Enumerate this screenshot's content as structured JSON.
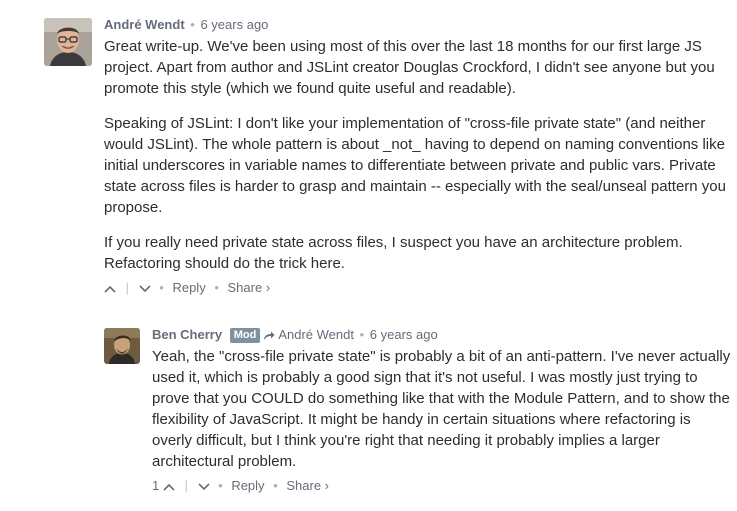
{
  "comments": [
    {
      "author": "André Wendt",
      "time": "6 years ago",
      "paragraphs": [
        "Great write-up. We've been using most of this over the last 18 months for our first large JS project. Apart from author and JSLint creator Douglas Crockford, I didn't see anyone but you promote this style (which we found quite useful and readable).",
        "Speaking of JSLint: I don't like your implementation of \"cross-file private state\" (and neither would JSLint). The whole pattern is about _not_ having to depend on naming conventions like initial underscores in variable names to differentiate between private and public vars. Private state across files is harder to grasp and maintain -- especially with the seal/unseal pattern you propose.",
        "If you really need private state across files, I suspect you have an architecture problem. Refactoring should do the trick here."
      ],
      "upvotes": "",
      "reply": "Reply",
      "share": "Share ›"
    },
    {
      "author": "Ben Cherry",
      "badge": "Mod",
      "reply_to": "André Wendt",
      "time": "6 years ago",
      "paragraphs": [
        "Yeah, the \"cross-file private state\" is probably a bit of an anti-pattern. I've never actually used it, which is probably a good sign that it's not useful. I was mostly just trying to prove that you COULD do something like that with the Module Pattern, and to show the flexibility of JavaScript. It might be handy in certain situations where refactoring is overly difficult, but I think you're right that needing it probably implies a larger architectural problem."
      ],
      "upvotes": "1",
      "reply": "Reply",
      "share": "Share ›"
    }
  ]
}
